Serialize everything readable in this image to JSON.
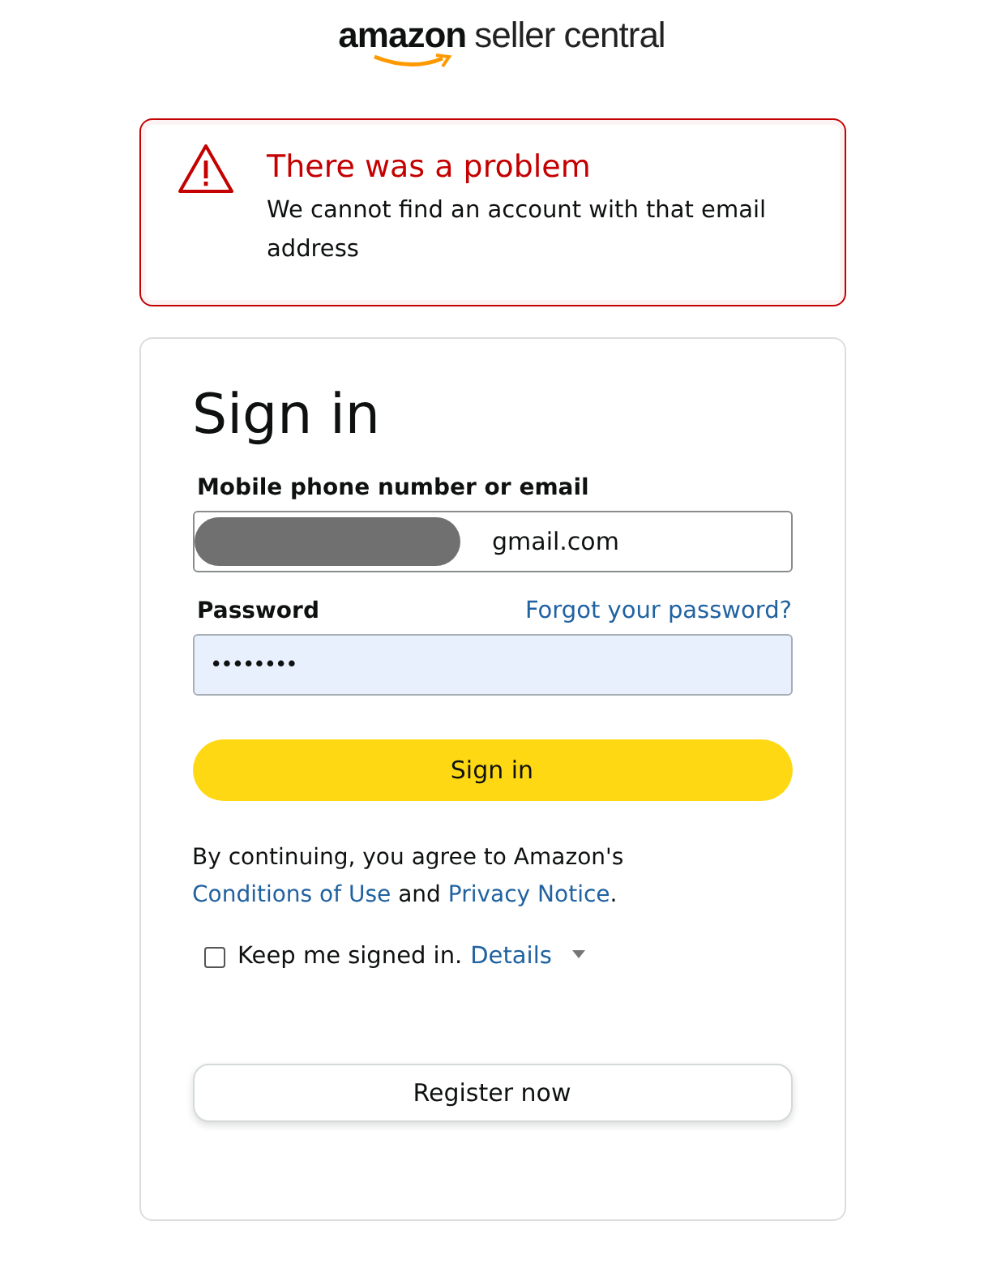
{
  "logo": {
    "brand": "amazon",
    "product": "seller central"
  },
  "alert": {
    "title": "There was a problem",
    "message": "We cannot find an account with that email address"
  },
  "form": {
    "heading": "Sign in",
    "email": {
      "label": "Mobile phone number or email",
      "value": "gmail.com",
      "redacted": true
    },
    "password": {
      "label": "Password",
      "forgot_link": "Forgot your password?",
      "value": "••••••••",
      "focused": true
    },
    "submit": "Sign in",
    "legal": {
      "before": "By continuing, you agree to Amazon's",
      "link1": "Conditions of Use",
      "middle": "and",
      "link2": "Privacy Notice",
      "after": "."
    },
    "keep_signed_in": {
      "label": "Keep me signed in.",
      "checked": false,
      "details_link": "Details"
    },
    "register": "Register now"
  }
}
